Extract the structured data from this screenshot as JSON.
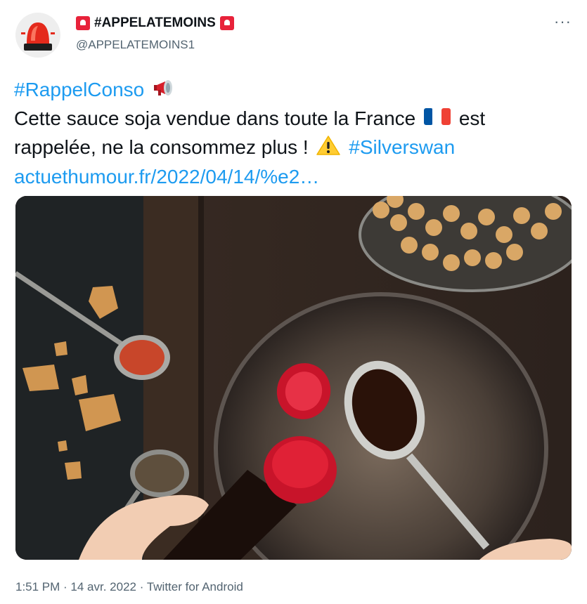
{
  "author": {
    "display_name": "#APPELATEMOINS",
    "handle": "@APPELATEMOINS1",
    "name_emoji": "siren-badge",
    "avatar_icon": "siren-light-icon"
  },
  "menu": {
    "more_label": "···"
  },
  "tweet": {
    "hashtag1": "#RappelConso",
    "line1": "Cette sauce soja vendue dans toute la France",
    "line1b": "est",
    "line2": "rappelée, ne la consommez plus !",
    "hashtag2": "#Silverswan",
    "link": "actuethumour.fr/2022/04/14/%e2…",
    "emojis": [
      "megaphone-icon",
      "french-flag-icon",
      "warning-icon"
    ]
  },
  "media": {
    "icon": "photo-soy-sauce-icon"
  },
  "footer": {
    "time": "1:51 PM",
    "separator": " · ",
    "date": "14 avr. 2022",
    "source": "Twitter for Android"
  },
  "colors": {
    "link": "#1d9bf0",
    "text": "#0f1419",
    "muted": "#536471",
    "siren": "#e8223a"
  }
}
